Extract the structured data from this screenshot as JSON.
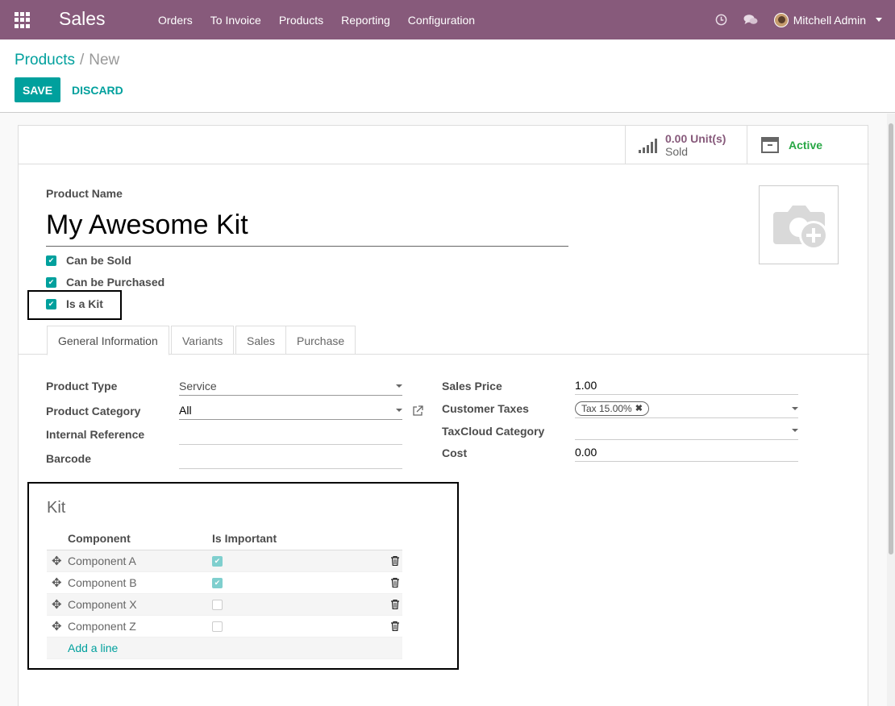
{
  "navbar": {
    "app_name": "Sales",
    "menu": [
      "Orders",
      "To Invoice",
      "Products",
      "Reporting",
      "Configuration"
    ],
    "user": "Mitchell Admin",
    "bg_color": "#875a7b",
    "icons": [
      "apps-grid-icon",
      "clock-icon",
      "chat-icon",
      "avatar",
      "caret-down-icon"
    ]
  },
  "breadcrumb": {
    "parent": "Products",
    "separator": "/",
    "current": "New"
  },
  "actions": {
    "save": "SAVE",
    "discard": "DISCARD"
  },
  "smart_buttons": {
    "sold_value": "0.00 Unit(s)",
    "sold_label": "Sold",
    "active_label": "Active"
  },
  "product": {
    "name_label": "Product Name",
    "name": "My Awesome Kit",
    "checkboxes": [
      {
        "label": "Can be Sold",
        "checked": true
      },
      {
        "label": "Can be Purchased",
        "checked": true
      },
      {
        "label": "Is a Kit",
        "checked": true
      }
    ]
  },
  "tabs": [
    "General Information",
    "Variants",
    "Sales",
    "Purchase"
  ],
  "general": {
    "product_type_label": "Product Type",
    "product_type": "Service",
    "product_category_label": "Product Category",
    "product_category": "All",
    "internal_reference_label": "Internal Reference",
    "internal_reference": "",
    "barcode_label": "Barcode",
    "barcode": "",
    "sales_price_label": "Sales Price",
    "sales_price": "1.00",
    "customer_taxes_label": "Customer Taxes",
    "customer_tax_tag": "Tax 15.00%",
    "taxcloud_label": "TaxCloud Category",
    "taxcloud": "",
    "cost_label": "Cost",
    "cost": "0.00"
  },
  "kit": {
    "title": "Kit",
    "col_component": "Component",
    "col_important": "Is Important",
    "rows": [
      {
        "component": "Component A",
        "important": true
      },
      {
        "component": "Component B",
        "important": true
      },
      {
        "component": "Component X",
        "important": false
      },
      {
        "component": "Component Z",
        "important": false
      }
    ],
    "add_line": "Add a line"
  },
  "colors": {
    "primary": "#00a09d",
    "brand": "#875a7b",
    "active_green": "#28a745"
  }
}
